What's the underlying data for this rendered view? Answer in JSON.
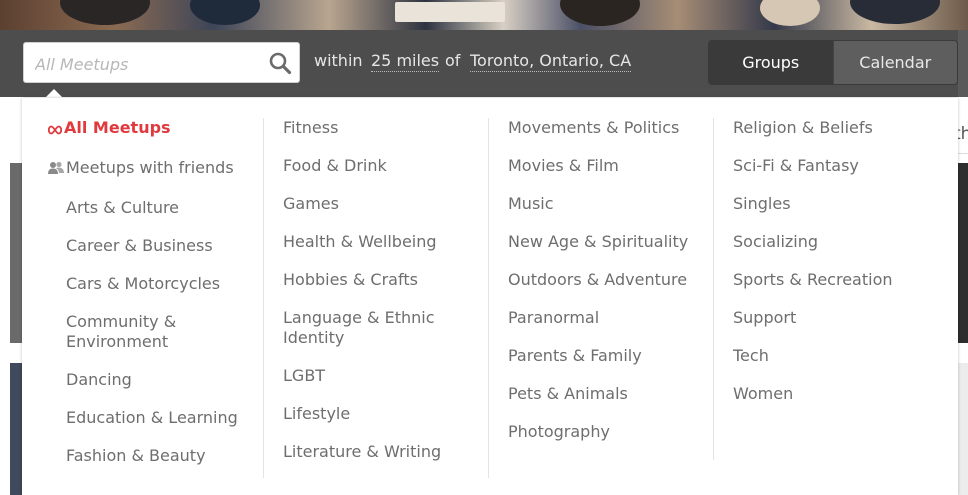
{
  "search": {
    "placeholder": "All Meetups",
    "within_label": "within",
    "distance": "25 miles",
    "of_label": "of",
    "location": "Toronto, Ontario, CA"
  },
  "view_toggle": {
    "groups_label": "Groups",
    "calendar_label": "Calendar",
    "active": "Groups"
  },
  "colors": {
    "accent": "#e0393e",
    "band": "#4d4d4d",
    "item_text": "#6e6e6e"
  },
  "categories": {
    "col1": [
      {
        "label": "All Meetups",
        "icon": "infinity-icon",
        "active": true
      },
      {
        "label": "Meetups with friends",
        "icon": "friends-icon"
      },
      {
        "label": "Arts & Culture"
      },
      {
        "label": "Career & Business"
      },
      {
        "label": "Cars & Motorcycles"
      },
      {
        "label": "Community & Environment"
      },
      {
        "label": "Dancing"
      },
      {
        "label": "Education & Learning"
      },
      {
        "label": "Fashion & Beauty"
      }
    ],
    "col2": [
      {
        "label": "Fitness"
      },
      {
        "label": "Food & Drink"
      },
      {
        "label": "Games"
      },
      {
        "label": "Health & Wellbeing"
      },
      {
        "label": "Hobbies & Crafts"
      },
      {
        "label": "Language & Ethnic Identity"
      },
      {
        "label": "LGBT"
      },
      {
        "label": "Lifestyle"
      },
      {
        "label": "Literature & Writing"
      }
    ],
    "col3": [
      {
        "label": "Movements & Politics"
      },
      {
        "label": "Movies & Film"
      },
      {
        "label": "Music"
      },
      {
        "label": "New Age & Spirituality"
      },
      {
        "label": "Outdoors & Adventure"
      },
      {
        "label": "Paranormal"
      },
      {
        "label": "Parents & Family"
      },
      {
        "label": "Pets & Animals"
      },
      {
        "label": "Photography"
      }
    ],
    "col4": [
      {
        "label": "Religion & Beliefs"
      },
      {
        "label": "Sci-Fi & Fantasy"
      },
      {
        "label": "Singles"
      },
      {
        "label": "Socializing"
      },
      {
        "label": "Sports & Recreation"
      },
      {
        "label": "Support"
      },
      {
        "label": "Tech"
      },
      {
        "label": "Women"
      }
    ]
  },
  "background_page": {
    "right_edge_text": "th"
  }
}
